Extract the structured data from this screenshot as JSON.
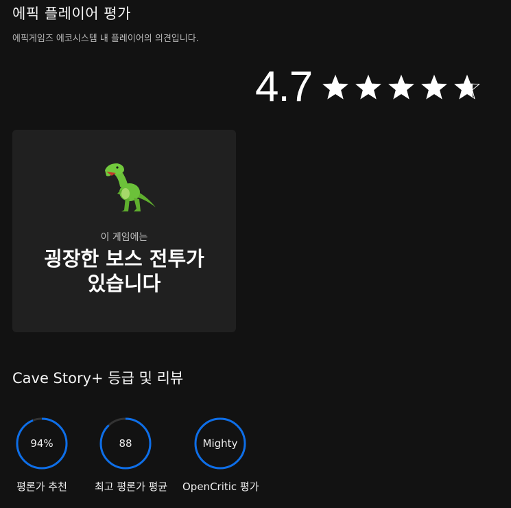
{
  "header": {
    "title": "에픽 플레이어 평가",
    "subtitle": "에픽게임즈 에코시스템 내 플레이어의 의견입니다."
  },
  "rating": {
    "value": "4.7",
    "stars": 4.7,
    "max_stars": 5
  },
  "highlight_card": {
    "icon": "dinosaur-icon",
    "caption": "이 게임에는",
    "text_line1": "굉장한 보스 전투가",
    "text_line2": "있습니다"
  },
  "reviews": {
    "title": "Cave Story+ 등급 및 리뷰",
    "scores": [
      {
        "value": "94%",
        "label": "평론가 추천",
        "fraction": 0.94
      },
      {
        "value": "88",
        "label": "최고 평론가 평균",
        "fraction": 0.88
      },
      {
        "value": "Mighty",
        "label": "OpenCritic 평가",
        "fraction": 1.0
      }
    ]
  },
  "colors": {
    "background": "#121212",
    "card": "#202020",
    "accent_blue": "#0d6ee8",
    "ring_track": "#333333"
  }
}
